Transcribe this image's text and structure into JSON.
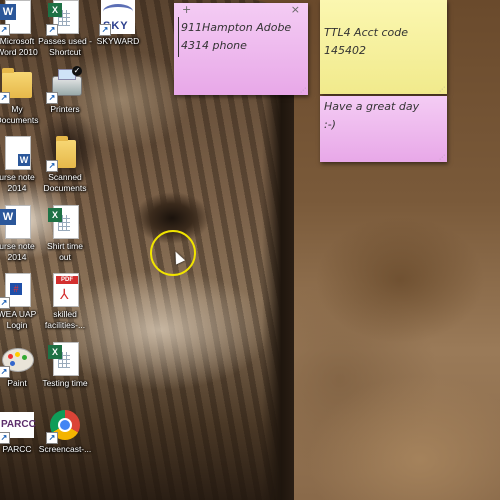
{
  "desktop": {
    "wallpaper": "tabby-kitten-closeup",
    "icons": [
      {
        "label": "Microsoft\nWord 2010",
        "icon": "word-icon"
      },
      {
        "label": "Passes used -\nShortcut",
        "icon": "excel-icon"
      },
      {
        "label": "SKYWARD",
        "icon": "skyward-icon"
      },
      {
        "label": "My\nDocuments",
        "icon": "folder-icon"
      },
      {
        "label": "Printers",
        "icon": "printer-icon"
      },
      {
        "label": "urse note\n2014",
        "icon": "word-doc-icon"
      },
      {
        "label": "Scanned\nDocuments",
        "icon": "folder-icon"
      },
      {
        "label": "urse note\n2014",
        "icon": "word-icon"
      },
      {
        "label": "Shirt time\nout",
        "icon": "excel-icon"
      },
      {
        "label": "WEA UAP\nLogin",
        "icon": "web-shortcut-icon"
      },
      {
        "label": "skilled\nfacilities-...",
        "icon": "pdf-icon"
      },
      {
        "label": "Paint",
        "icon": "paint-icon"
      },
      {
        "label": "Testing time",
        "icon": "excel-icon"
      },
      {
        "label": "PARCC",
        "icon": "parcc-icon"
      },
      {
        "label": "Screencast-...",
        "icon": "chrome-icon"
      }
    ]
  },
  "sticky_notes": [
    {
      "color": "pink",
      "lines": [
        "911Hampton Adobe",
        "4314 phone"
      ],
      "add_glyph": "+",
      "close_glyph": "×"
    },
    {
      "color": "yellow",
      "lines": [
        "TTL4 Acct code",
        "145402"
      ]
    },
    {
      "color": "pink",
      "lines": [
        "Have a great day",
        ":-)"
      ]
    }
  ],
  "colors": {
    "note_pink": "#f0c0f0",
    "note_yellow": "#f8f3a6",
    "cursor_highlight": "#f1e400"
  }
}
